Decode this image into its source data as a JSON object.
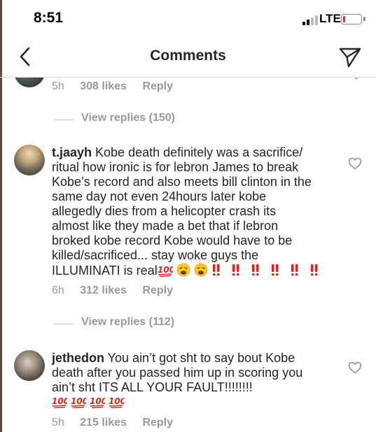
{
  "status_bar": {
    "time": "8:51",
    "network": "LTE"
  },
  "nav": {
    "title": "Comments",
    "back_icon": "chevron-left-icon",
    "direct_icon": "paper-plane-icon"
  },
  "comments": [
    {
      "username": "",
      "text": "",
      "age": "5h",
      "likes": "308 likes",
      "reply_label": "Reply",
      "view_replies": "View replies (150)"
    },
    {
      "username": "t.jaayh",
      "text_lines": [
        " Kobe death definitely was a sacrifice/",
        "ritual how ironic is for lebron James to break",
        "Kobe’s record and also meets bill clinton in the",
        "same day not even 24hours later kobe",
        "allegedly dies from a helicopter crash its",
        "almost like they made a bet that if lebron",
        "broked kobe record Kobe would have to be",
        "killed/sacrificed... stay woke guys the",
        "ILLUMINATI is real"
      ],
      "trailing_emojis": "💯😩😩‼️‼️‼️‼️‼️‼️",
      "age": "6h",
      "likes": "312 likes",
      "reply_label": "Reply",
      "view_replies": "View replies (112)"
    },
    {
      "username": "jethedon",
      "text_lines": [
        " You ain’t got sht to say bout Kobe",
        "death after you passed him up in scoring you",
        "ain’t sht ITS ALL YOUR FAULT!!!!!!!!"
      ],
      "trailing_emojis": "💯💯💯💯",
      "age": "5h",
      "likes": "215 likes",
      "reply_label": "Reply"
    }
  ],
  "colors": {
    "text": "#262626",
    "secondary": "#999999",
    "divider": "#dbdbdb",
    "emoji_red": "#e0241b"
  }
}
